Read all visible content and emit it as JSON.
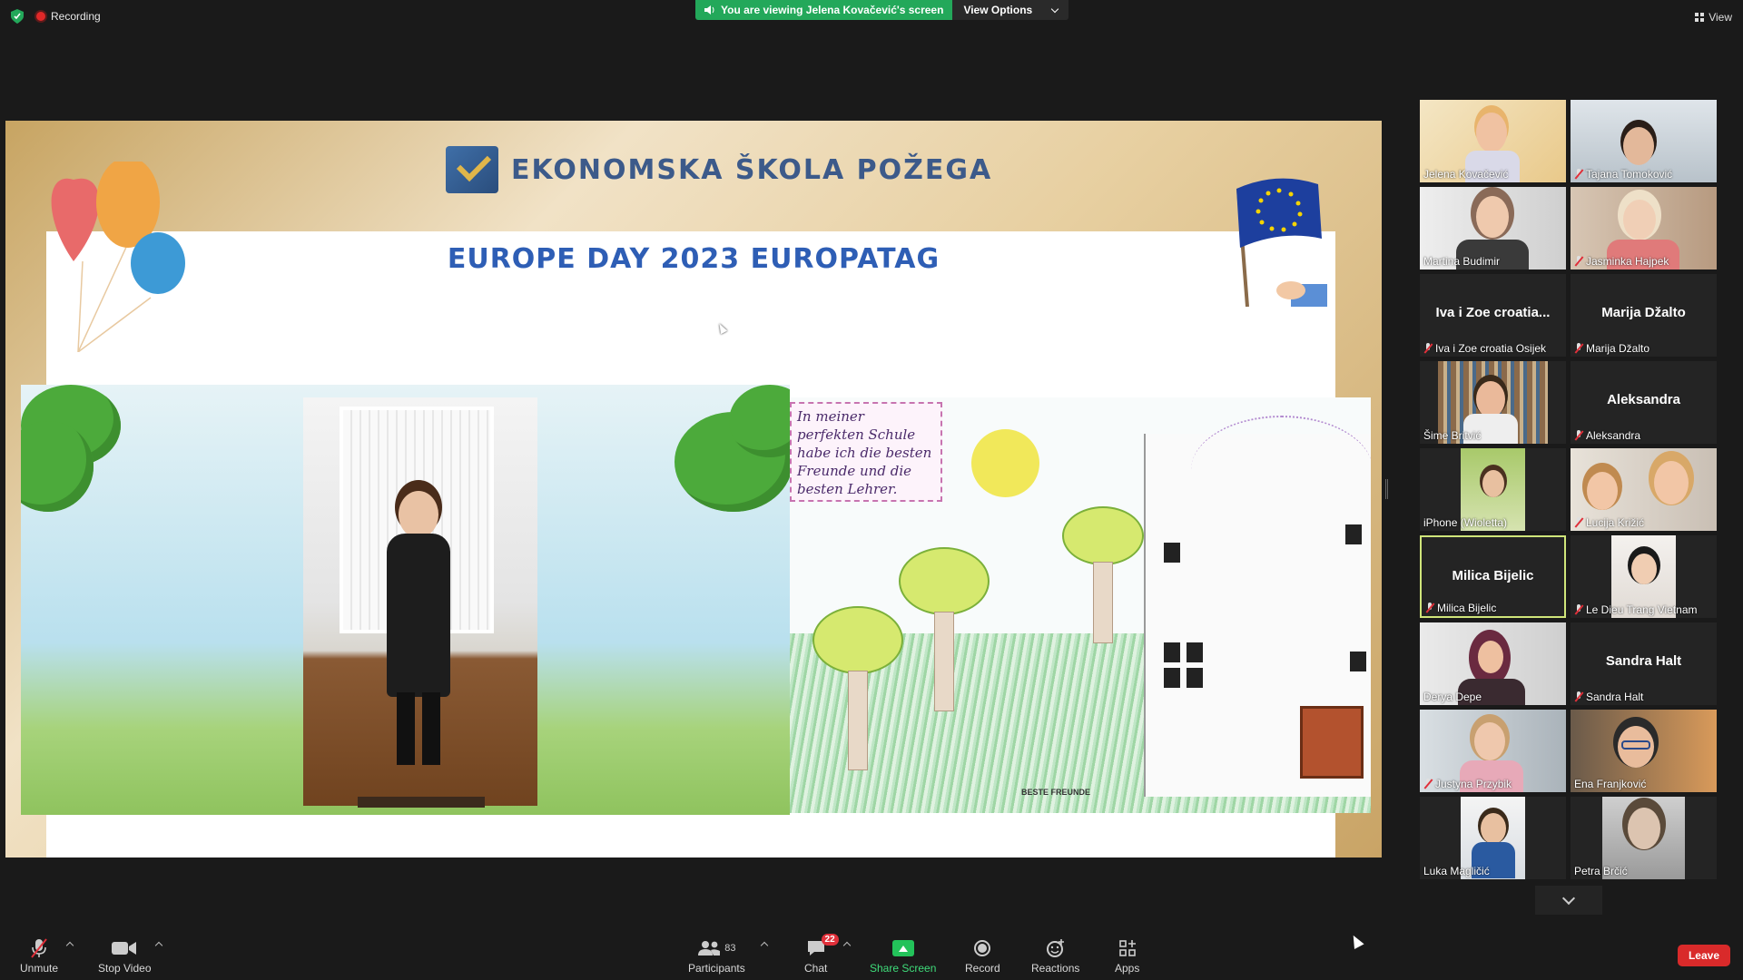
{
  "top": {
    "recording_label": "Recording",
    "viewing_banner": "You are viewing Jelena Kovačević's screen",
    "view_options_label": "View Options",
    "view_label": "View"
  },
  "slide": {
    "school_name": "EKONOMSKA ŠKOLA POŽEGA",
    "title": "EUROPE DAY 2023 EUROPATAG",
    "drawing_note": "In meiner perfekten Schule habe ich die besten Freunde und die besten Lehrer.",
    "drawing_signature": "BESTE FREUNDE"
  },
  "participants": [
    {
      "name": "Jelena Kovačević",
      "muted": false,
      "video": true
    },
    {
      "name": "Tajana Tomoković",
      "muted": true,
      "video": true
    },
    {
      "name": "Martina Budimir",
      "muted": false,
      "video": true
    },
    {
      "name": "Jasminka Hajpek",
      "muted": true,
      "video": true
    },
    {
      "name": "Iva i Zoe croatia Osijek",
      "display": "Iva i Zoe croatia...",
      "muted": true,
      "video": false
    },
    {
      "name": "Marija Džalto",
      "display": "Marija Džalto",
      "muted": true,
      "video": false
    },
    {
      "name": "Šime Britvić",
      "muted": false,
      "video": true
    },
    {
      "name": "Aleksandra",
      "display": "Aleksandra",
      "muted": true,
      "video": false
    },
    {
      "name": "iPhone (Wioletta)",
      "muted": false,
      "video": true
    },
    {
      "name": "Lucija Križić",
      "muted": true,
      "video": true
    },
    {
      "name": "Milica Bijelic",
      "display": "Milica Bijelic",
      "muted": true,
      "video": false,
      "active": true
    },
    {
      "name": "Le Dieu Trang Vietnam",
      "muted": true,
      "video": true
    },
    {
      "name": "Derya Depe",
      "muted": false,
      "video": true
    },
    {
      "name": "Sandra Halt",
      "display": "Sandra Halt",
      "muted": true,
      "video": false
    },
    {
      "name": "Justyna Przybik",
      "muted": true,
      "video": true
    },
    {
      "name": "Ena Franjković",
      "muted": false,
      "video": true
    },
    {
      "name": "Luka Magličić",
      "muted": false,
      "video": true
    },
    {
      "name": "Petra Brčić",
      "muted": false,
      "video": true
    }
  ],
  "toolbar": {
    "unmute": "Unmute",
    "stop_video": "Stop Video",
    "participants": "Participants",
    "participants_count": "83",
    "chat": "Chat",
    "chat_badge": "22",
    "share_screen": "Share Screen",
    "record": "Record",
    "reactions": "Reactions",
    "apps": "Apps",
    "leave": "Leave"
  },
  "colors": {
    "share_green": "#23a85a",
    "leave_red": "#d92a2a",
    "active_speaker": "#cfe57a",
    "slide_title_blue": "#2e5eb5"
  }
}
